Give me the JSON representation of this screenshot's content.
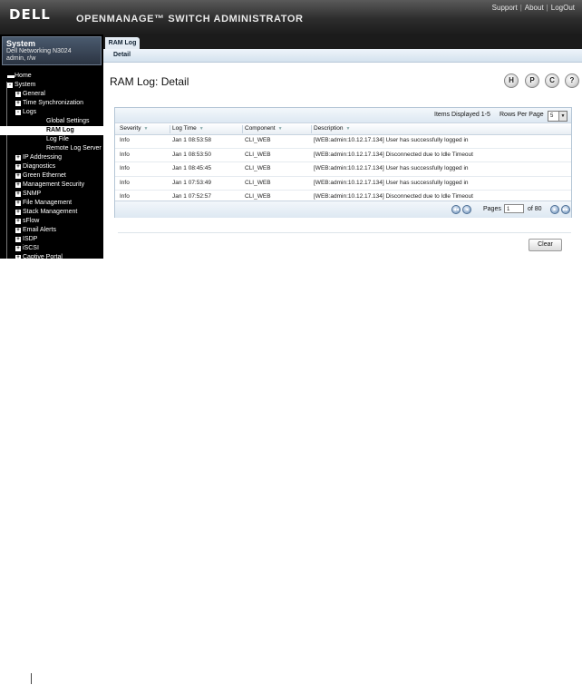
{
  "header": {
    "logo_text": "DELL",
    "app_title": "OPENMANAGE™ SWITCH ADMINISTRATOR",
    "links": [
      "Support",
      "About",
      "LogOut"
    ]
  },
  "system": {
    "title": "System",
    "model": "Dell Networking N3024",
    "user": "admin, r/w"
  },
  "nav": {
    "items": [
      {
        "label": "Home",
        "level": 0,
        "toggle": ""
      },
      {
        "label": "System",
        "level": 0,
        "toggle": "-"
      },
      {
        "label": "General",
        "level": 1,
        "toggle": "+"
      },
      {
        "label": "Time Synchronization",
        "level": 1,
        "toggle": "+"
      },
      {
        "label": "Logs",
        "level": 1,
        "toggle": "-"
      },
      {
        "label": "Global Settings",
        "level": 2,
        "toggle": ""
      },
      {
        "label": "RAM Log",
        "level": 2,
        "toggle": "",
        "active": true
      },
      {
        "label": "Log File",
        "level": 2,
        "toggle": ""
      },
      {
        "label": "Remote Log Server",
        "level": 2,
        "toggle": ""
      },
      {
        "label": "IP Addressing",
        "level": 1,
        "toggle": "+"
      },
      {
        "label": "Diagnostics",
        "level": 1,
        "toggle": "+"
      },
      {
        "label": "Green Ethernet",
        "level": 1,
        "toggle": "+"
      },
      {
        "label": "Management Security",
        "level": 1,
        "toggle": "+"
      },
      {
        "label": "SNMP",
        "level": 1,
        "toggle": "+"
      },
      {
        "label": "File Management",
        "level": 1,
        "toggle": "+"
      },
      {
        "label": "Stack Management",
        "level": 1,
        "toggle": "+"
      },
      {
        "label": "sFlow",
        "level": 1,
        "toggle": "+"
      },
      {
        "label": "Email Alerts",
        "level": 1,
        "toggle": "+"
      },
      {
        "label": "ISDP",
        "level": 1,
        "toggle": "+"
      },
      {
        "label": "iSCSI",
        "level": 1,
        "toggle": "+"
      },
      {
        "label": "Captive Portal",
        "level": 1,
        "toggle": "+"
      }
    ]
  },
  "tabs": {
    "main_tab": "RAM Log",
    "sub_tab": "Detail"
  },
  "page": {
    "title": "RAM Log: Detail",
    "tools": [
      "H",
      "P",
      "C",
      "?"
    ]
  },
  "table": {
    "items_displayed": "Items Displayed 1-5",
    "rows_per_page_label": "Rows Per Page",
    "rows_per_page_value": "5",
    "columns": [
      "Severity",
      "Log Time",
      "Component",
      "Description"
    ],
    "rows": [
      [
        "Info",
        "Jan 1 08:53:58",
        "CLI_WEB",
        "[WEB:admin:10.12.17.134] User has successfully logged in"
      ],
      [
        "Info",
        "Jan 1 08:53:50",
        "CLI_WEB",
        "[WEB:admin:10.12.17.134] Disconnected due to Idle Timeout"
      ],
      [
        "Info",
        "Jan 1 08:45:45",
        "CLI_WEB",
        "[WEB:admin:10.12.17.134] User has successfully logged in"
      ],
      [
        "Info",
        "Jan 1 07:53:49",
        "CLI_WEB",
        "[WEB:admin:10.12.17.134] User has successfully logged in"
      ],
      [
        "Info",
        "Jan 1 07:52:57",
        "CLI_WEB",
        "[WEB:admin:10.12.17.134] Disconnected due to Idle Timeout"
      ]
    ],
    "pages_label": "Pages",
    "page_value": "1",
    "of_label": "of 80"
  },
  "actions": {
    "clear_label": "Clear"
  }
}
